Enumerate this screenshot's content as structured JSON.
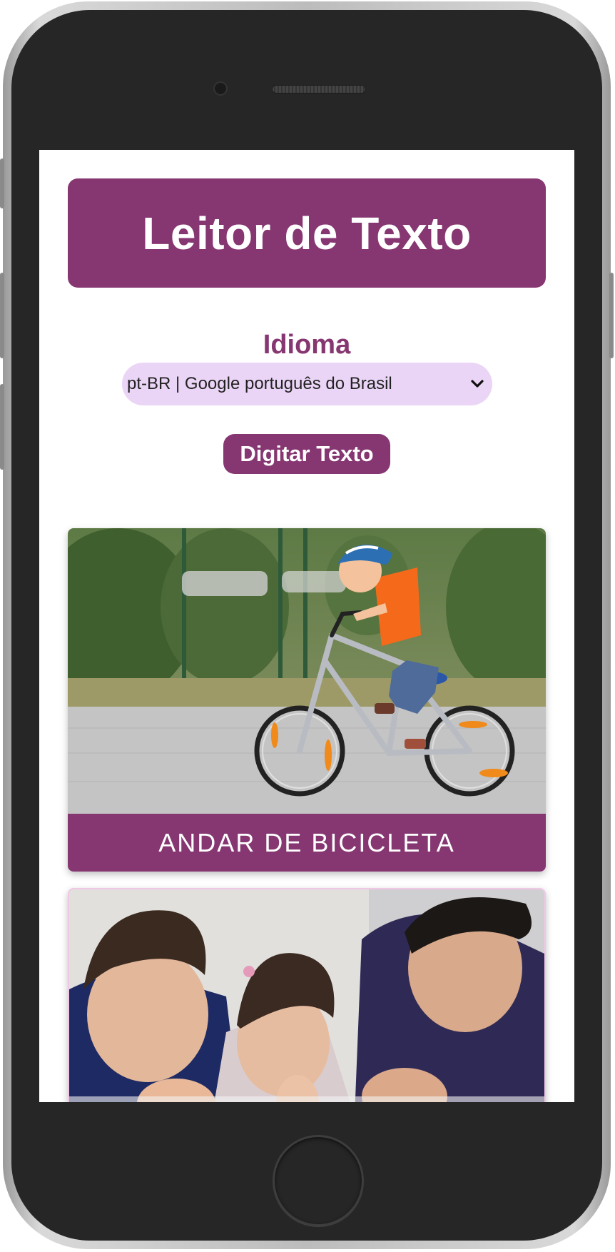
{
  "app": {
    "title": "Leitor de Texto"
  },
  "language": {
    "label": "Idioma",
    "selected": "pt-BR | Google português do Brasil"
  },
  "actions": {
    "type_text_label": "Digitar Texto"
  },
  "cards": [
    {
      "caption": "ANDAR DE BICICLETA",
      "image": "child-riding-bicycle"
    },
    {
      "caption": "",
      "image": "family-praying"
    }
  ],
  "colors": {
    "brand": "#863671",
    "select_bg": "#ebd5f6",
    "screen_bg": "#ffffff",
    "device_body": "#262626"
  }
}
